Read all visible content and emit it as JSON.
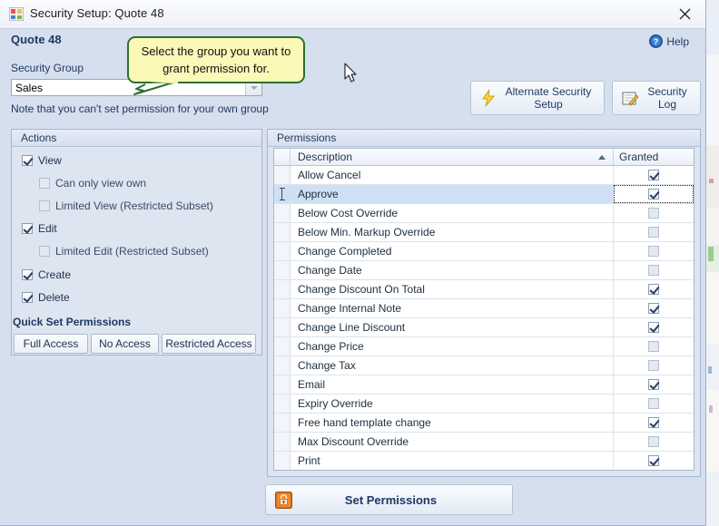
{
  "window": {
    "title": "Security Setup: Quote 48",
    "icon": "app-form-icon",
    "close_label": "✕"
  },
  "header": {
    "page_title": "Quote 48",
    "security_group_label": "Security Group",
    "security_group_value": "Sales",
    "note": "Note that you can't set permission for your own group",
    "help_label": "Help"
  },
  "toolbar": {
    "alternate_security_setup": "Alternate Security Setup",
    "security_log": "Security Log"
  },
  "callout": {
    "text": "Select the group you want to grant permission for."
  },
  "actions_panel": {
    "title": "Actions",
    "items": [
      {
        "label": "View",
        "checked": true,
        "indent": 0,
        "enabled": true
      },
      {
        "label": "Can only view own",
        "checked": false,
        "indent": 1,
        "enabled": false
      },
      {
        "label": "Limited View (Restricted Subset)",
        "checked": false,
        "indent": 1,
        "enabled": false
      },
      {
        "label": "Edit",
        "checked": true,
        "indent": 0,
        "enabled": true
      },
      {
        "label": "Limited Edit (Restricted Subset)",
        "checked": false,
        "indent": 1,
        "enabled": false
      },
      {
        "label": "Create",
        "checked": true,
        "indent": 0,
        "enabled": true
      },
      {
        "label": "Delete",
        "checked": true,
        "indent": 0,
        "enabled": true
      }
    ],
    "quick_set_title": "Quick Set Permissions",
    "quick_set_buttons": [
      "Full Access",
      "No Access",
      "Restricted Access"
    ]
  },
  "permissions_panel": {
    "title": "Permissions",
    "columns": [
      "Description",
      "Granted"
    ],
    "sort_column": "Description",
    "sort_direction": "ascending",
    "rows": [
      {
        "description": "Allow Cancel",
        "granted": true,
        "selected": false
      },
      {
        "description": "Approve",
        "granted": true,
        "selected": true
      },
      {
        "description": "Below Cost Override",
        "granted": false,
        "selected": false
      },
      {
        "description": "Below Min. Markup Override",
        "granted": false,
        "selected": false
      },
      {
        "description": "Change Completed",
        "granted": false,
        "selected": false
      },
      {
        "description": "Change Date",
        "granted": false,
        "selected": false
      },
      {
        "description": "Change Discount On Total",
        "granted": true,
        "selected": false
      },
      {
        "description": "Change Internal Note",
        "granted": true,
        "selected": false
      },
      {
        "description": "Change Line Discount",
        "granted": true,
        "selected": false
      },
      {
        "description": "Change Price",
        "granted": false,
        "selected": false
      },
      {
        "description": "Change Tax",
        "granted": false,
        "selected": false
      },
      {
        "description": "Email",
        "granted": true,
        "selected": false
      },
      {
        "description": "Expiry Override",
        "granted": false,
        "selected": false
      },
      {
        "description": "Free hand template change",
        "granted": true,
        "selected": false
      },
      {
        "description": "Max Discount Override",
        "granted": false,
        "selected": false
      },
      {
        "description": "Print",
        "granted": true,
        "selected": false
      }
    ]
  },
  "footer": {
    "set_permissions_label": "Set Permissions",
    "set_permissions_icon": "lock-icon"
  },
  "colors": {
    "window_background": "#d6dfee",
    "panel_background": "#dde5f1",
    "accent_text": "#1f3864",
    "selection": "#cfe0f4",
    "callout_fill": "#fbf8b8",
    "callout_border": "#2d7030"
  }
}
